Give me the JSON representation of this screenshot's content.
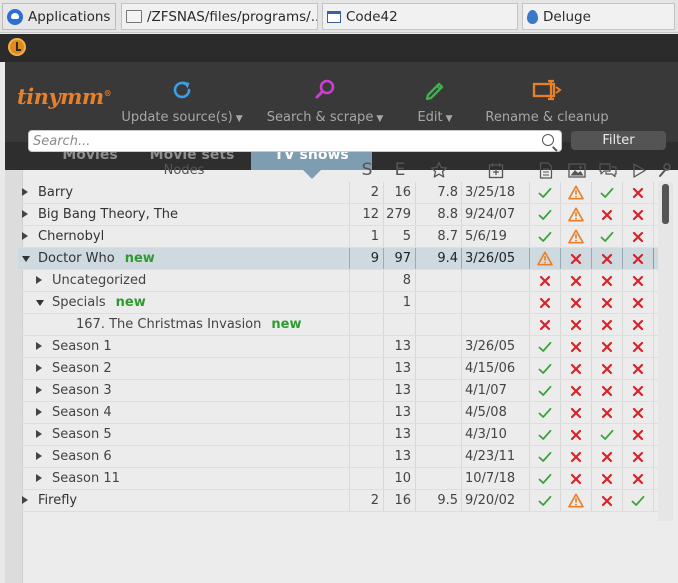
{
  "taskbar": {
    "items": [
      {
        "label": "Applications",
        "icon": "applications-icon"
      },
      {
        "label": "/ZFSNAS/files/programs/...",
        "icon": "folder-icon"
      },
      {
        "label": "Code42",
        "icon": "window-icon"
      },
      {
        "label": "Deluge",
        "icon": "deluge-icon"
      }
    ]
  },
  "app": {
    "logo": "tinymm",
    "logo_mark": "®",
    "toolbar": {
      "update_label": "Update source(s)",
      "search_label": "Search & scrape",
      "edit_label": "Edit",
      "rename_label": "Rename & cleanup"
    },
    "tabs": [
      "Movies",
      "Movie sets",
      "TV shows"
    ],
    "active_tab": "TV shows",
    "search_placeholder": "Search...",
    "filter_label": "Filter",
    "columns": {
      "nodes": "Nodes",
      "s": "S",
      "e": "E"
    },
    "colors": {
      "accent": "#e8802a",
      "tab_active": "#7e9db0",
      "ok": "#3aa33a",
      "no": "#d8232a",
      "warn": "#e8802a",
      "new": "#2f9a2f"
    }
  },
  "rows": [
    {
      "level": 0,
      "expand": "collapsed",
      "title": "Barry",
      "is_new": false,
      "s": "2",
      "e": "16",
      "rating": "7.8",
      "date": "3/25/18",
      "i": [
        "ok",
        "warn",
        "ok",
        "no"
      ]
    },
    {
      "level": 0,
      "expand": "collapsed",
      "title": "Big Bang Theory, The",
      "is_new": false,
      "s": "12",
      "e": "279",
      "rating": "8.8",
      "date": "9/24/07",
      "i": [
        "ok",
        "warn",
        "no",
        "no"
      ]
    },
    {
      "level": 0,
      "expand": "collapsed",
      "title": "Chernobyl",
      "is_new": false,
      "s": "1",
      "e": "5",
      "rating": "8.7",
      "date": "5/6/19",
      "i": [
        "ok",
        "warn",
        "ok",
        "no"
      ]
    },
    {
      "level": 0,
      "expand": "expanded",
      "title": "Doctor Who",
      "is_new": true,
      "s": "9",
      "e": "97",
      "rating": "9.4",
      "date": "3/26/05",
      "i": [
        "warn",
        "no",
        "no",
        "no"
      ],
      "selected": true
    },
    {
      "level": 1,
      "expand": "collapsed",
      "title": "Uncategorized",
      "is_new": false,
      "s": "",
      "e": "8",
      "rating": "",
      "date": "",
      "i": [
        "no",
        "no",
        "no",
        "no"
      ]
    },
    {
      "level": 1,
      "expand": "expanded",
      "title": "Specials",
      "is_new": true,
      "s": "",
      "e": "1",
      "rating": "",
      "date": "",
      "i": [
        "no",
        "no",
        "no",
        "no"
      ]
    },
    {
      "level": 2,
      "expand": "none",
      "title": "167. The Christmas Invasion",
      "is_new": true,
      "s": "",
      "e": "",
      "rating": "",
      "date": "",
      "i": [
        "no",
        "no",
        "no",
        "no"
      ]
    },
    {
      "level": 1,
      "expand": "collapsed",
      "title": "Season 1",
      "is_new": false,
      "s": "",
      "e": "13",
      "rating": "",
      "date": "3/26/05",
      "i": [
        "ok",
        "no",
        "no",
        "no"
      ]
    },
    {
      "level": 1,
      "expand": "collapsed",
      "title": "Season 2",
      "is_new": false,
      "s": "",
      "e": "13",
      "rating": "",
      "date": "4/15/06",
      "i": [
        "ok",
        "no",
        "no",
        "no"
      ]
    },
    {
      "level": 1,
      "expand": "collapsed",
      "title": "Season 3",
      "is_new": false,
      "s": "",
      "e": "13",
      "rating": "",
      "date": "4/1/07",
      "i": [
        "ok",
        "no",
        "no",
        "no"
      ]
    },
    {
      "level": 1,
      "expand": "collapsed",
      "title": "Season 4",
      "is_new": false,
      "s": "",
      "e": "13",
      "rating": "",
      "date": "4/5/08",
      "i": [
        "ok",
        "no",
        "no",
        "no"
      ]
    },
    {
      "level": 1,
      "expand": "collapsed",
      "title": "Season 5",
      "is_new": false,
      "s": "",
      "e": "13",
      "rating": "",
      "date": "4/3/10",
      "i": [
        "ok",
        "no",
        "ok",
        "no"
      ]
    },
    {
      "level": 1,
      "expand": "collapsed",
      "title": "Season 6",
      "is_new": false,
      "s": "",
      "e": "13",
      "rating": "",
      "date": "4/23/11",
      "i": [
        "ok",
        "no",
        "no",
        "no"
      ]
    },
    {
      "level": 1,
      "expand": "collapsed",
      "title": "Season 11",
      "is_new": false,
      "s": "",
      "e": "10",
      "rating": "",
      "date": "10/7/18",
      "i": [
        "ok",
        "no",
        "no",
        "no"
      ]
    },
    {
      "level": 0,
      "expand": "collapsed",
      "title": "Firefly",
      "is_new": false,
      "s": "2",
      "e": "16",
      "rating": "9.5",
      "date": "9/20/02",
      "i": [
        "ok",
        "warn",
        "no",
        "ok"
      ]
    }
  ]
}
